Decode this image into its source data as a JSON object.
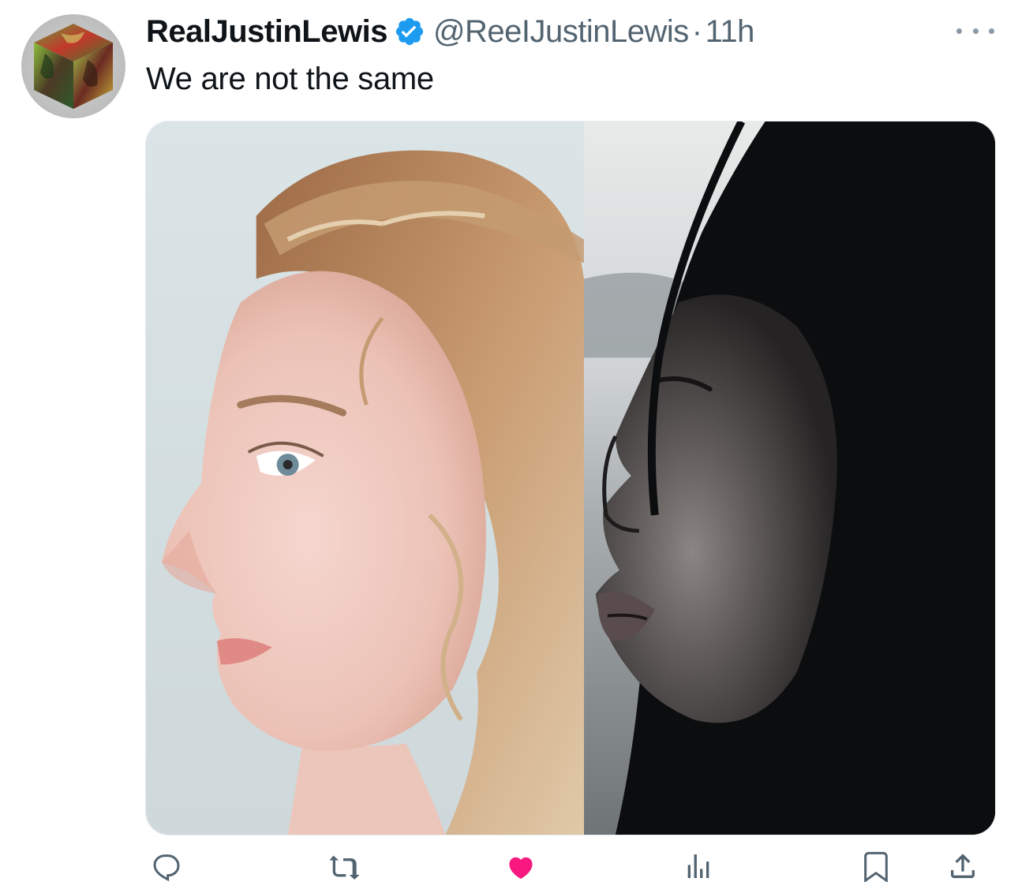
{
  "tweet": {
    "display_name": "RealJustinLewis",
    "handle": "@ReeIJustinLewis",
    "separator": "·",
    "time": "11h",
    "text": "We are not the same",
    "verified": true
  },
  "avatar": {
    "icon": "cube-avatar-icon"
  },
  "media": {
    "left_image": "woman-profile-light-photo",
    "right_image": "woman-profile-dark-photo"
  },
  "actions": [
    {
      "name": "reply-button",
      "icon": "reply-icon"
    },
    {
      "name": "retweet-button",
      "icon": "retweet-icon"
    },
    {
      "name": "like-button",
      "icon": "heart-icon"
    },
    {
      "name": "views-button",
      "icon": "bar-chart-icon"
    },
    {
      "name": "bookmark-button",
      "icon": "bookmark-icon"
    },
    {
      "name": "share-button",
      "icon": "share-icon"
    }
  ],
  "colors": {
    "text_primary": "#0f1419",
    "text_secondary": "#536471",
    "verified_blue": "#1d9bf0",
    "like_pink": "#f91880"
  }
}
